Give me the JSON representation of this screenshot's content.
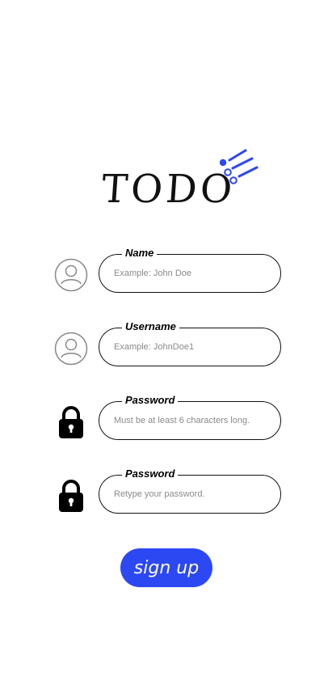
{
  "app": {
    "logo_text": "TODO"
  },
  "colors": {
    "accent": "#2c48f3",
    "text": "#111111",
    "placeholder": "#8a8a8a",
    "icon_gray": "#888888"
  },
  "form": {
    "fields": [
      {
        "label": "Name",
        "placeholder": "Example: John Doe",
        "icon": "user-circle-icon"
      },
      {
        "label": "Username",
        "placeholder": "Example: JohnDoe1",
        "icon": "user-circle-icon"
      },
      {
        "label": "Password",
        "placeholder": "Must be at least 6 characters long.",
        "icon": "lock-icon"
      },
      {
        "label": "Password",
        "placeholder": "Retype your password.",
        "icon": "lock-icon"
      }
    ],
    "submit_label": "sign up"
  }
}
